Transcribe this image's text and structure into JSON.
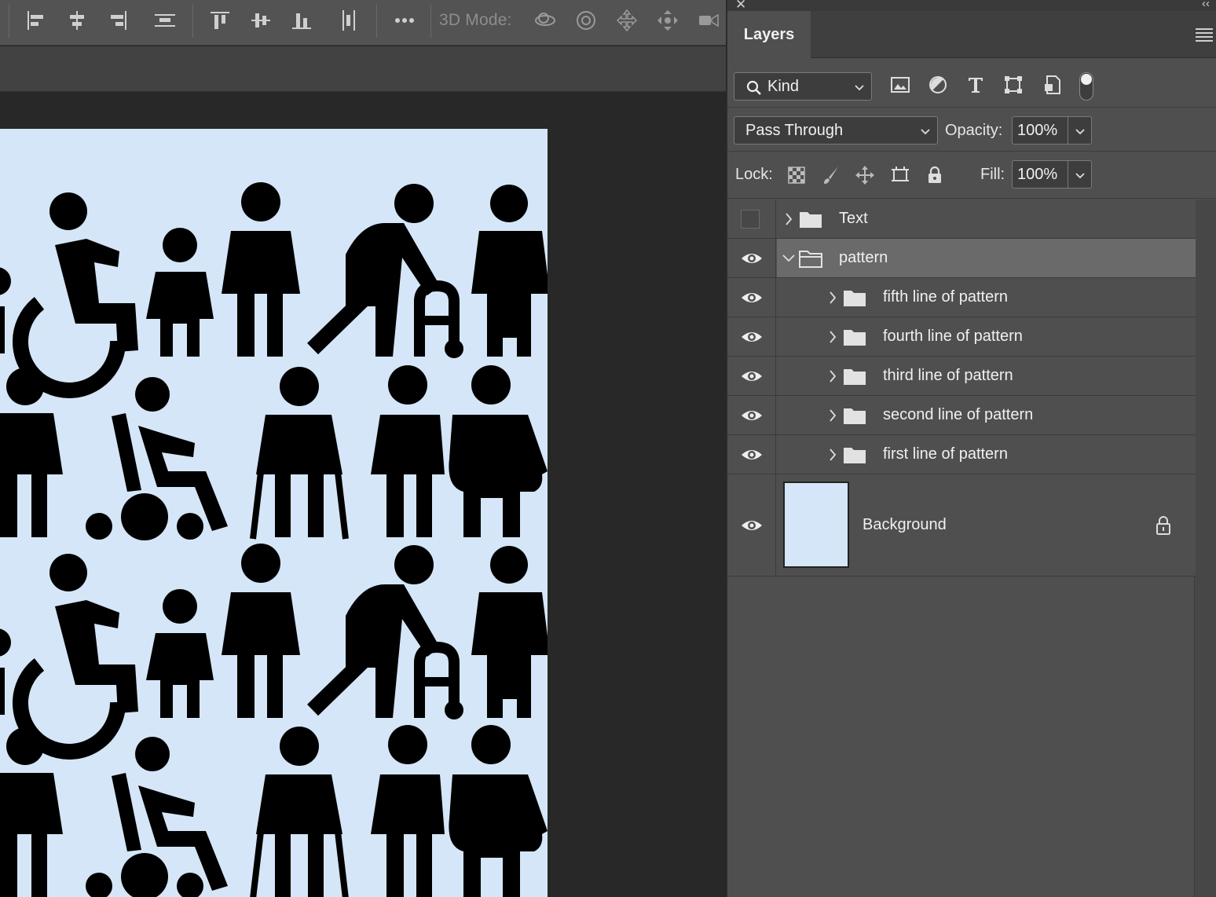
{
  "options_bar": {
    "mode_3d_label": "3D Mode:",
    "tools": [
      "align-left-edges",
      "align-horizontal-centers",
      "align-right-edges",
      "distribute-horizontal",
      "align-top-edges",
      "align-vertical-centers",
      "align-bottom-edges",
      "distribute-vertical",
      "more"
    ],
    "mode_3d_tools": [
      "orbit-3d",
      "roll-3d",
      "pan-3d",
      "slide-3d",
      "scale-3d"
    ]
  },
  "layers_panel": {
    "tab_label": "Layers",
    "filter": {
      "kind_label": "Kind",
      "filter_icons": [
        "pixel-layer-filter",
        "adjustment-layer-filter",
        "type-layer-filter",
        "shape-layer-filter",
        "smart-object-filter"
      ]
    },
    "blend_mode": "Pass Through",
    "opacity_label": "Opacity:",
    "opacity_value": "100%",
    "lock_label": "Lock:",
    "fill_label": "Fill:",
    "fill_value": "100%",
    "layers": [
      {
        "name": "Text",
        "type": "group",
        "visible": false,
        "expanded": false,
        "selected": false,
        "indent": 0
      },
      {
        "name": "pattern",
        "type": "group",
        "visible": true,
        "expanded": true,
        "selected": true,
        "indent": 0
      },
      {
        "name": "fifth line of pattern",
        "type": "group",
        "visible": true,
        "expanded": false,
        "selected": false,
        "indent": 1
      },
      {
        "name": "fourth line of pattern",
        "type": "group",
        "visible": true,
        "expanded": false,
        "selected": false,
        "indent": 1
      },
      {
        "name": "third line of pattern",
        "type": "group",
        "visible": true,
        "expanded": false,
        "selected": false,
        "indent": 1
      },
      {
        "name": "second line of pattern",
        "type": "group",
        "visible": true,
        "expanded": false,
        "selected": false,
        "indent": 1
      },
      {
        "name": "first line of pattern",
        "type": "group",
        "visible": true,
        "expanded": false,
        "selected": false,
        "indent": 1
      },
      {
        "name": "Background",
        "type": "background",
        "visible": true,
        "locked": true,
        "selected": false,
        "indent": 0
      }
    ]
  },
  "colors": {
    "artboard_bg": "#d4e6f7",
    "panel_bg": "#4f4f4f",
    "selected_row": "#6a6a6a",
    "pasteboard": "#282828"
  }
}
